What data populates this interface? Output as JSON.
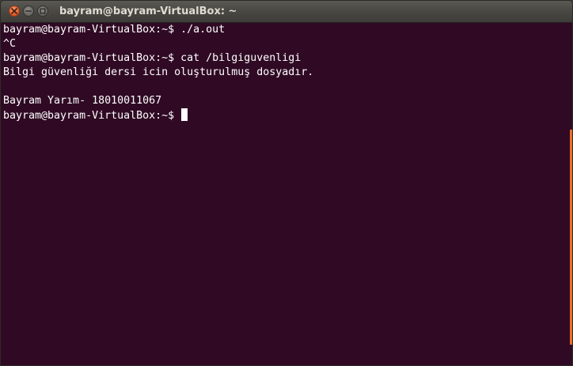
{
  "window": {
    "title": "bayram@bayram-VirtualBox: ~",
    "controls": {
      "close_icon": "close-icon",
      "minimize_icon": "minimize-icon",
      "maximize_icon": "maximize-icon"
    }
  },
  "terminal": {
    "background": "#300a24",
    "foreground": "#ffffff",
    "scrollbar_color": "#ef6f2a",
    "lines": [
      "bayram@bayram-VirtualBox:~$ ./a.out",
      "^C",
      "bayram@bayram-VirtualBox:~$ cat /bilgiguvenligi",
      "Bilgi güvenliği dersi icin oluşturulmuş dosyadır.",
      "",
      "Bayram Yarım- 18010011067"
    ],
    "prompt": "bayram@bayram-VirtualBox:~$ "
  }
}
